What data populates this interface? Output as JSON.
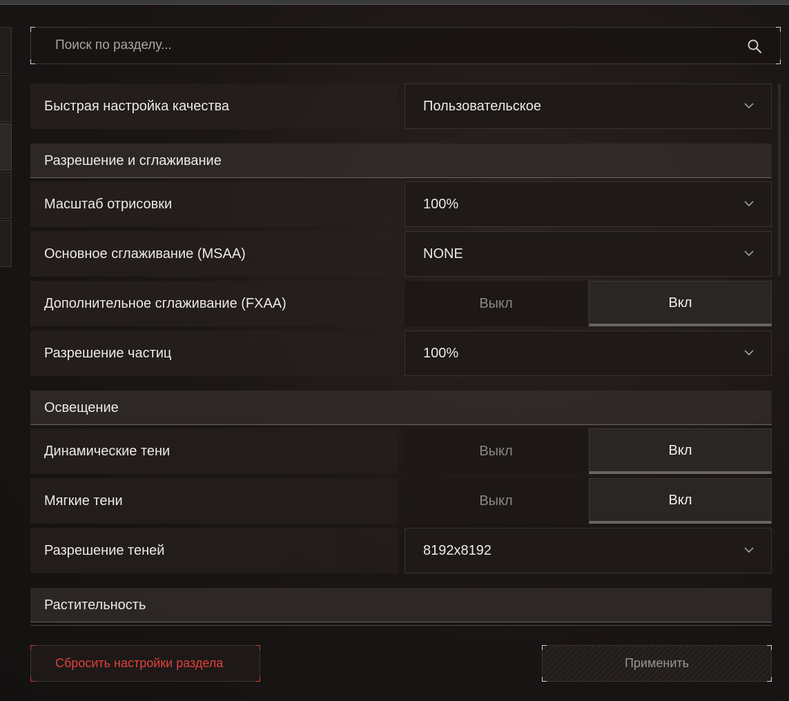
{
  "search": {
    "placeholder": "Поиск по разделу..."
  },
  "settings": {
    "quick_quality": {
      "label": "Быстрая настройка качества",
      "value": "Пользовательское"
    },
    "section_resolution": "Разрешение и сглаживание",
    "render_scale": {
      "label": "Масштаб отрисовки",
      "value": "100%"
    },
    "msaa": {
      "label": "Основное сглаживание (MSAA)",
      "value": "NONE"
    },
    "fxaa": {
      "label": "Дополнительное сглаживание (FXAA)",
      "off": "Выкл",
      "on": "Вкл",
      "selected": "on"
    },
    "particle_res": {
      "label": "Разрешение частиц",
      "value": "100%"
    },
    "section_lighting": "Освещение",
    "dynamic_shadows": {
      "label": "Динамические тени",
      "off": "Выкл",
      "on": "Вкл",
      "selected": "on"
    },
    "soft_shadows": {
      "label": "Мягкие тени",
      "off": "Выкл",
      "on": "Вкл",
      "selected": "on"
    },
    "shadow_res": {
      "label": "Разрешение теней",
      "value": "8192x8192"
    },
    "section_vegetation": "Растительность"
  },
  "footer": {
    "reset_label": "Сбросить настройки раздела",
    "apply_label": "Применить"
  },
  "icons": {
    "search": "search-icon",
    "dropdown": "chevron-down-icon"
  },
  "colors": {
    "accent_red": "#e0403a",
    "background": "#1c1716"
  }
}
